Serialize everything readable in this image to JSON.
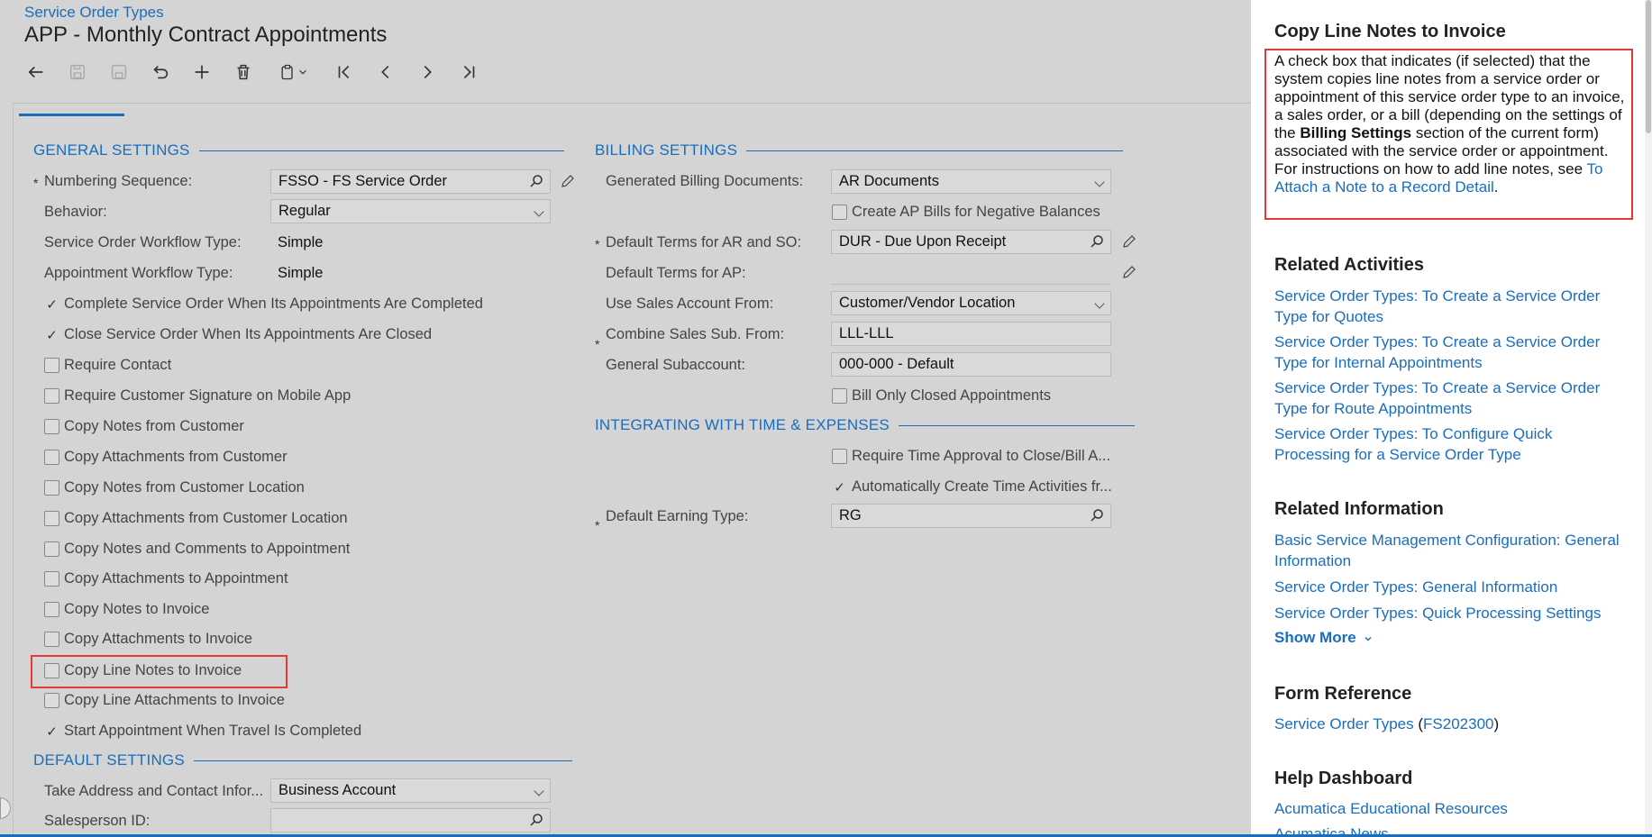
{
  "breadcrumb": "Service Order Types",
  "title": "APP - Monthly Contract Appointments",
  "general": {
    "header": "GENERAL SETTINGS",
    "numbering_label": "Numbering Sequence:",
    "numbering_value": "FSSO - FS Service Order",
    "behavior_label": "Behavior:",
    "behavior_value": "Regular",
    "so_workflow_label": "Service Order Workflow Type:",
    "so_workflow_value": "Simple",
    "appt_workflow_label": "Appointment Workflow Type:",
    "appt_workflow_value": "Simple",
    "checkboxes": [
      {
        "label": "Complete Service Order When Its Appointments Are Completed",
        "checked": true
      },
      {
        "label": "Close Service Order When Its Appointments Are Closed",
        "checked": true
      },
      {
        "label": "Require Contact",
        "checked": false
      },
      {
        "label": "Require Customer Signature on Mobile App",
        "checked": false
      },
      {
        "label": "Copy Notes from Customer",
        "checked": false
      },
      {
        "label": "Copy Attachments from Customer",
        "checked": false
      },
      {
        "label": "Copy Notes from Customer Location",
        "checked": false
      },
      {
        "label": "Copy Attachments from Customer Location",
        "checked": false
      },
      {
        "label": "Copy Notes and Comments to Appointment",
        "checked": false
      },
      {
        "label": "Copy Attachments to Appointment",
        "checked": false
      },
      {
        "label": "Copy Notes to Invoice",
        "checked": false
      },
      {
        "label": "Copy Attachments to Invoice",
        "checked": false
      },
      {
        "label": "Copy Line Notes to Invoice",
        "checked": false
      },
      {
        "label": "Copy Line Attachments to Invoice",
        "checked": false
      },
      {
        "label": "Start Appointment When Travel Is Completed",
        "checked": true
      }
    ]
  },
  "default_settings": {
    "header": "DEFAULT SETTINGS",
    "address_label": "Take Address and Contact Infor...",
    "address_value": "Business Account",
    "salesperson_label": "Salesperson ID:",
    "salesperson_value": ""
  },
  "billing": {
    "header": "BILLING SETTINGS",
    "gen_docs_label": "Generated Billing Documents:",
    "gen_docs_value": "AR Documents",
    "ap_bills_label": "Create AP Bills for Negative Balances",
    "terms_ar_label": "Default Terms for AR and SO:",
    "terms_ar_value": "DUR - Due Upon Receipt",
    "terms_ap_label": "Default Terms for AP:",
    "terms_ap_value": "",
    "sales_acct_label": "Use Sales Account From:",
    "sales_acct_value": "Customer/Vendor Location",
    "combine_label": "Combine Sales Sub. From:",
    "combine_value": "LLL-LLL",
    "gen_sub_label": "General Subaccount:",
    "gen_sub_value": "000-000 - Default",
    "bill_closed_label": "Bill Only Closed Appointments"
  },
  "time_expenses": {
    "header": "INTEGRATING WITH TIME & EXPENSES",
    "approval_label": "Require Time Approval to Close/Bill A...",
    "auto_create_label": "Automatically Create Time Activities fr...",
    "earning_label": "Default Earning Type:",
    "earning_value": "RG"
  },
  "help": {
    "title": "Copy Line Notes to Invoice",
    "desc_1": "A check box that indicates (if selected) that the system copies line notes from a service order or appointment of this service order type to an invoice, a sales order, or a bill (depending on the settings of the ",
    "desc_bold": "Billing Settings",
    "desc_2": " section of the current form) associated with the service order or appointment.",
    "desc_3": "For instructions on how to add line notes, see ",
    "desc_link": "To Attach a Note to a Record Detail",
    "desc_end": ".",
    "related_activities_title": "Related Activities",
    "related_activities": [
      "Service Order Types: To Create a Service Order Type for Quotes",
      "Service Order Types: To Create a Service Order Type for Internal Appointments",
      "Service Order Types: To Create a Service Order Type for Route Appointments",
      "Service Order Types: To Configure Quick Processing for a Service Order Type"
    ],
    "related_info_title": "Related Information",
    "related_info": [
      "Basic Service Management Configuration: General Information",
      "Service Order Types: General Information",
      "Service Order Types: Quick Processing Settings"
    ],
    "show_more": "Show More",
    "form_ref_title": "Form Reference",
    "form_ref_link": "Service Order Types",
    "form_ref_paren_open": " (",
    "form_ref_code": "FS202300",
    "form_ref_paren_close": ")",
    "dashboard_title": "Help Dashboard",
    "dashboard_links": [
      "Acumatica Educational Resources",
      "Acumatica News"
    ]
  }
}
